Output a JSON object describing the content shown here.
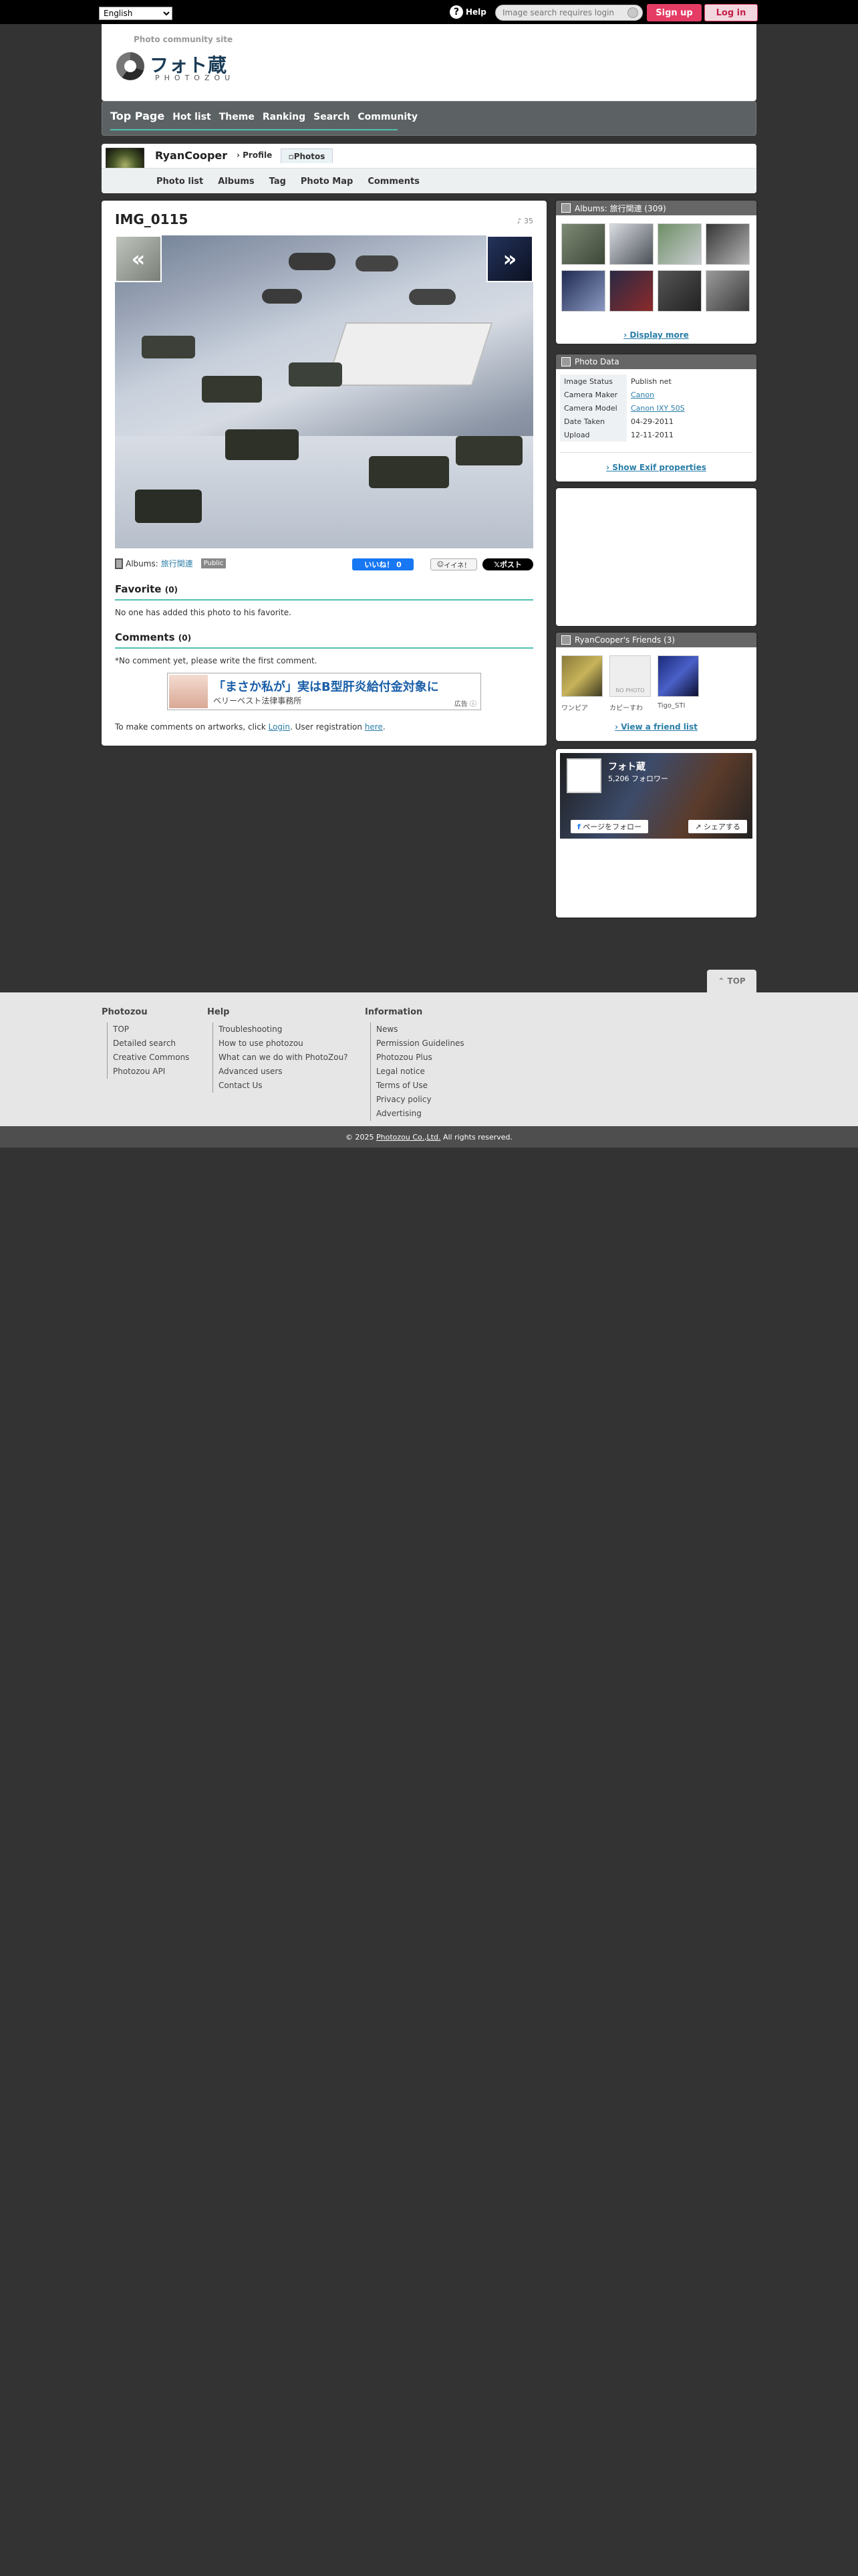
{
  "topbar": {
    "language": "English",
    "help_label": "Help",
    "search_placeholder": "Image search requires login",
    "signup_label": "Sign up",
    "login_label": "Log in"
  },
  "header": {
    "tagline": "Photo community site",
    "logo_jp": "フォト蔵",
    "logo_en": "PHOTOZOU"
  },
  "nav": {
    "items": [
      "Top Page",
      "Hot list",
      "Theme",
      "Ranking",
      "Search",
      "Community"
    ]
  },
  "user": {
    "name": "RyanCooper",
    "tab_profile": "Profile",
    "tab_photos": "Photos",
    "subnav": [
      "Photo list",
      "Albums",
      "Tag",
      "Photo Map",
      "Comments"
    ]
  },
  "photo": {
    "title": "IMG_0115",
    "view_count": "35",
    "prev_arrow": "«",
    "next_arrow": "»",
    "albums_label": "Albums:",
    "album_name": "旅行関連",
    "visibility": "Public",
    "like_label": "いいね！ 0",
    "iine_label": "イイネ！",
    "post_label": "ポスト"
  },
  "favorite": {
    "heading": "Favorite",
    "count": "(0)",
    "text": "No one has added this photo to his favorite."
  },
  "comments": {
    "heading": "Comments",
    "count": "(0)",
    "empty_text": "*No comment yet, please write the first comment.",
    "login_prefix": "To make comments on artworks, click ",
    "login_link": "Login",
    "login_mid": ". User registration ",
    "register_link": "here",
    "login_suffix": "."
  },
  "ad": {
    "title": "「まさか私が」実はB型肝炎給付金対象に",
    "sub": "ベリーベスト法律事務所",
    "label": "広告 ⓘ"
  },
  "sidebar": {
    "albums_head": "Albums: 旅行関連 (309)",
    "display_more": "Display more",
    "photo_data_head": "Photo Data",
    "exif": [
      {
        "key": "Image Status",
        "value": "Publish net",
        "link": false
      },
      {
        "key": "Camera Maker",
        "value": "Canon",
        "link": true
      },
      {
        "key": "Camera Model",
        "value": "Canon IXY 50S",
        "link": true
      },
      {
        "key": "Date Taken",
        "value": "04-29-2011",
        "link": false
      },
      {
        "key": "Upload",
        "value": "12-11-2011",
        "link": false
      }
    ],
    "show_exif": "Show Exif properties",
    "friends_head": "RyanCooper's Friends (3)",
    "friends": [
      "ワンピア",
      "カピーすわ",
      "Tigo_STI"
    ],
    "no_photo": "NO PHOTO",
    "view_friends": "View a friend list",
    "fb_name": "フォト蔵",
    "fb_followers": "5,206 フォロワー",
    "fb_follow": "ページをフォロー",
    "fb_share": "シェアする"
  },
  "to_top": "TOP",
  "footer": {
    "cols": [
      {
        "head": "Photozou",
        "links": [
          "TOP",
          "Detailed search",
          "Creative Commons",
          "Photozou API"
        ]
      },
      {
        "head": "Help",
        "links": [
          "Troubleshooting",
          "How to use photozou",
          "What can we do with PhotoZou?",
          "Advanced users",
          "Contact Us"
        ]
      },
      {
        "head": "Information",
        "links": [
          "News",
          "Permission Guidelines",
          "Photozou Plus",
          "Legal notice",
          "Terms of Use",
          "Privacy policy",
          "Advertising"
        ]
      }
    ],
    "copyright_prefix": "© 2025 ",
    "copyright_link": "Photozou Co.,Ltd.",
    "copyright_suffix": " All rights reserved."
  },
  "colors": {
    "accent": "#4fc1b0",
    "signup": "#e43c64",
    "nav_bg": "#5c6264",
    "link": "#2a7ea8"
  }
}
